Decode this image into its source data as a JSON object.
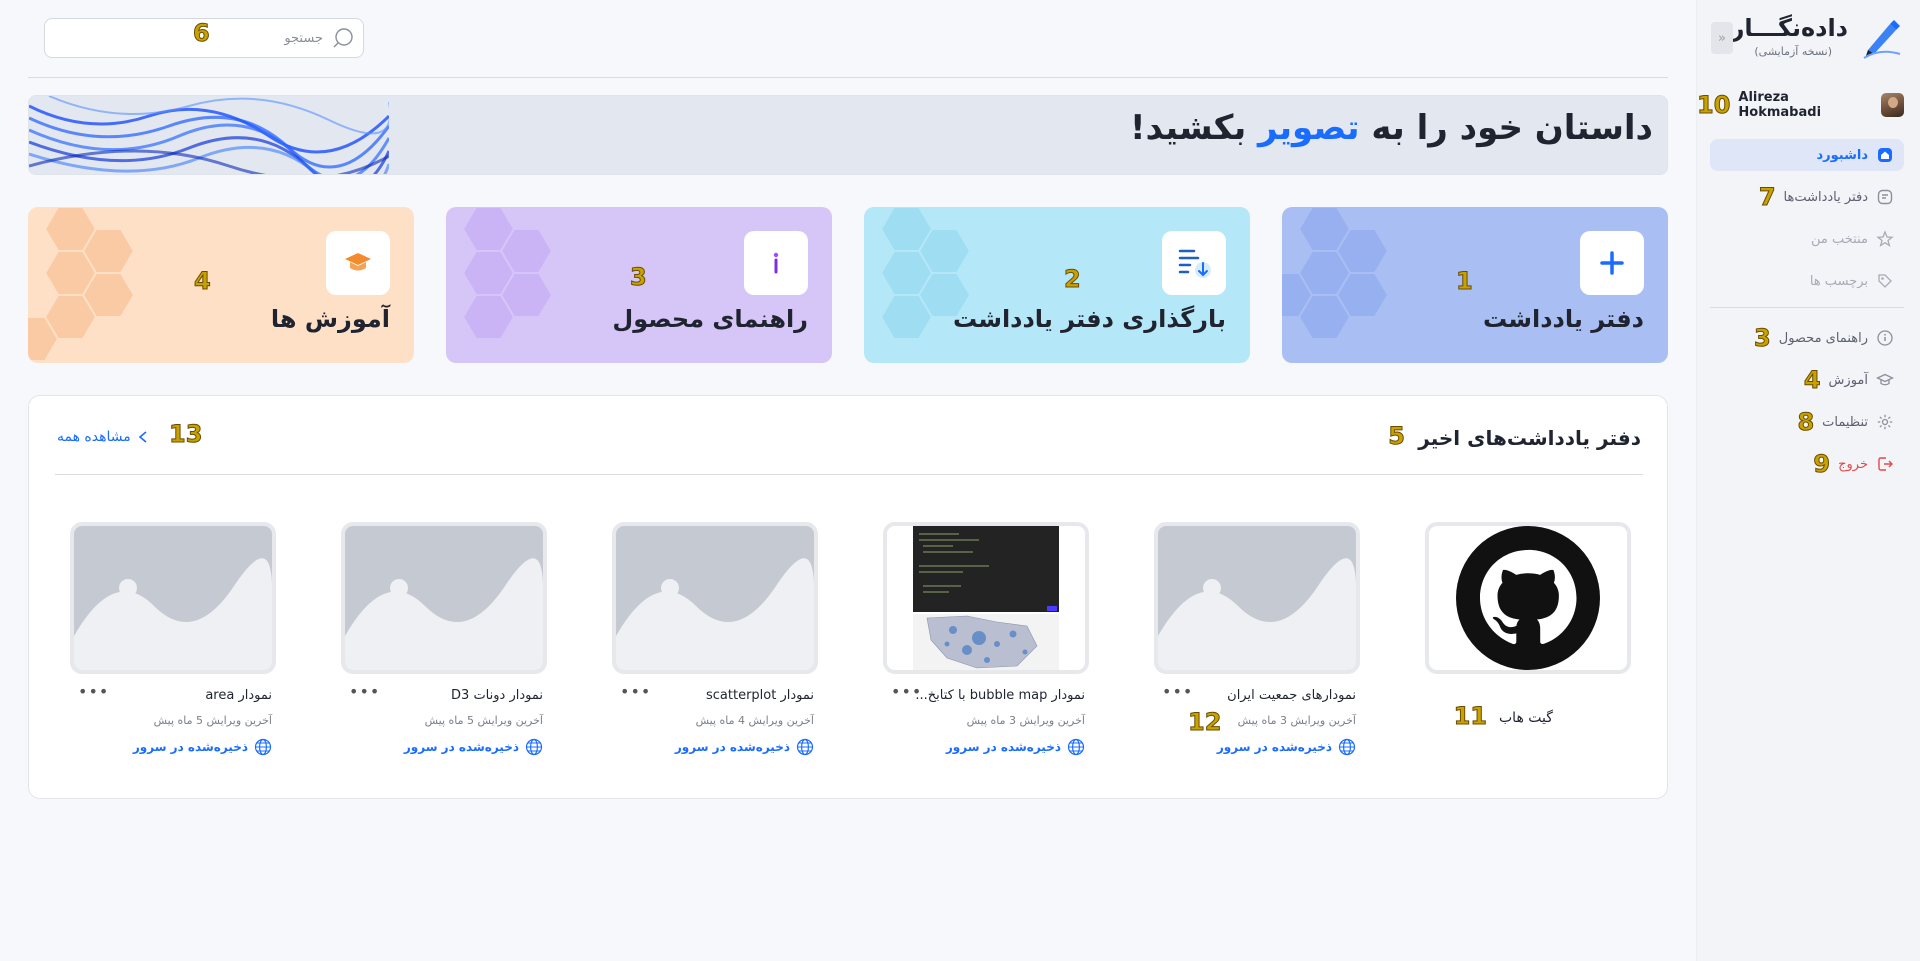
{
  "brand": {
    "name": "داده‌نگـــار",
    "subtitle": "(نسخه آزمایشی)"
  },
  "user": {
    "name": "Alireza Hokmabadi",
    "badge": "10"
  },
  "sidebar": {
    "collapse_label": "«",
    "items": [
      {
        "label": "داشبورد",
        "icon": "home-icon",
        "badge": ""
      },
      {
        "label": "دفتر یادداشت‌ها",
        "icon": "notebook-icon",
        "badge": "7"
      },
      {
        "label": "منتخب من",
        "icon": "star-icon",
        "badge": ""
      },
      {
        "label": "برچسب ها",
        "icon": "tag-icon",
        "badge": ""
      },
      {
        "label": "راهنمای محصول",
        "icon": "info-icon",
        "badge": "3"
      },
      {
        "label": "آموزش",
        "icon": "graduation-cap-icon",
        "badge": "4"
      },
      {
        "label": "تنظیمات",
        "icon": "gear-icon",
        "badge": "8"
      },
      {
        "label": "خروج",
        "icon": "logout-icon",
        "badge": "9"
      }
    ]
  },
  "search": {
    "placeholder": "جستجو",
    "value": "",
    "badge": "6"
  },
  "banner": {
    "title_before": "داستان خود را به ",
    "title_highlight": "تصویر",
    "title_after": " بکشید!"
  },
  "cards": [
    {
      "title": "دفتر یادداشت",
      "icon": "plus-icon",
      "badge": "1"
    },
    {
      "title": "بارگذاری دفتر یادداشت",
      "icon": "upload-list-icon",
      "badge": "2"
    },
    {
      "title": "راهنمای محصول",
      "icon": "info-icon",
      "badge": "3"
    },
    {
      "title": "آموزش ها",
      "icon": "graduation-cap-icon",
      "badge": "4"
    }
  ],
  "recent": {
    "title": "دفتر یادداشت‌های اخیر",
    "title_badge": "5",
    "see_all": "مشاهده همه",
    "see_all_badge": "13",
    "github": {
      "label": "گیت هاب",
      "badge": "11"
    },
    "status_badge": "12",
    "more_label": "•••",
    "notebooks": [
      {
        "name": "نمودارهای جمعیت ایران",
        "meta": "آخرین ویرایش 3 ماه پیش",
        "status": "ذخیره‌شده در سرور"
      },
      {
        "name": "نمودار bubble map با کتابخ...",
        "meta": "آخرین ویرایش 3 ماه پیش",
        "status": "ذخیره‌شده در سرور"
      },
      {
        "name": "نمودار scatterplot",
        "meta": "آخرین ویرایش 4 ماه پیش",
        "status": "ذخیره‌شده در سرور"
      },
      {
        "name": "نمودار دونات D3",
        "meta": "آخرین ویرایش 5 ماه پیش",
        "status": "ذخیره‌شده در سرور"
      },
      {
        "name": "نمودار area",
        "meta": "آخرین ویرایش 5 ماه پیش",
        "status": "ذخیره‌شده در سرور"
      }
    ]
  },
  "colors": {
    "accent": "#1a6cff",
    "danger": "#e5484d",
    "badge": "#c8a300"
  }
}
